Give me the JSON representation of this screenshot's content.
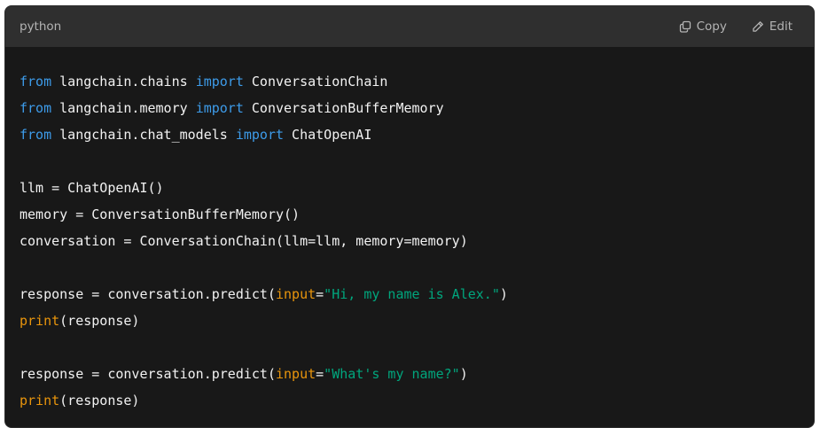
{
  "header": {
    "language": "python",
    "copy_label": "Copy",
    "edit_label": "Edit",
    "copy_icon": "copy-icon",
    "edit_icon": "pencil-icon"
  },
  "code": {
    "lines": [
      [
        {
          "t": "from",
          "c": "kw"
        },
        {
          "t": " langchain.chains ",
          "c": "plain"
        },
        {
          "t": "import",
          "c": "kw"
        },
        {
          "t": " ConversationChain",
          "c": "plain"
        }
      ],
      [
        {
          "t": "from",
          "c": "kw"
        },
        {
          "t": " langchain.memory ",
          "c": "plain"
        },
        {
          "t": "import",
          "c": "kw"
        },
        {
          "t": " ConversationBufferMemory",
          "c": "plain"
        }
      ],
      [
        {
          "t": "from",
          "c": "kw"
        },
        {
          "t": " langchain.chat_models ",
          "c": "plain"
        },
        {
          "t": "import",
          "c": "kw"
        },
        {
          "t": " ChatOpenAI",
          "c": "plain"
        }
      ],
      [],
      [
        {
          "t": "llm = ChatOpenAI()",
          "c": "plain"
        }
      ],
      [
        {
          "t": "memory = ConversationBufferMemory()",
          "c": "plain"
        }
      ],
      [
        {
          "t": "conversation = ConversationChain(llm=llm, memory=memory)",
          "c": "plain"
        }
      ],
      [],
      [
        {
          "t": "response = conversation.predict(",
          "c": "plain"
        },
        {
          "t": "input",
          "c": "param"
        },
        {
          "t": "=",
          "c": "plain"
        },
        {
          "t": "\"Hi, my name is Alex.\"",
          "c": "str"
        },
        {
          "t": ")",
          "c": "plain"
        }
      ],
      [
        {
          "t": "print",
          "c": "fn"
        },
        {
          "t": "(response)",
          "c": "plain"
        }
      ],
      [],
      [
        {
          "t": "response = conversation.predict(",
          "c": "plain"
        },
        {
          "t": "input",
          "c": "param"
        },
        {
          "t": "=",
          "c": "plain"
        },
        {
          "t": "\"What's my name?\"",
          "c": "str"
        },
        {
          "t": ")",
          "c": "plain"
        }
      ],
      [
        {
          "t": "print",
          "c": "fn"
        },
        {
          "t": "(response)",
          "c": "plain"
        }
      ]
    ]
  },
  "colors": {
    "keyword": "#3d9be9",
    "builtin": "#e9950c",
    "string": "#00a67d",
    "text": "#f2f2f2",
    "background": "#181818",
    "header_bg": "#2f2f2f"
  }
}
